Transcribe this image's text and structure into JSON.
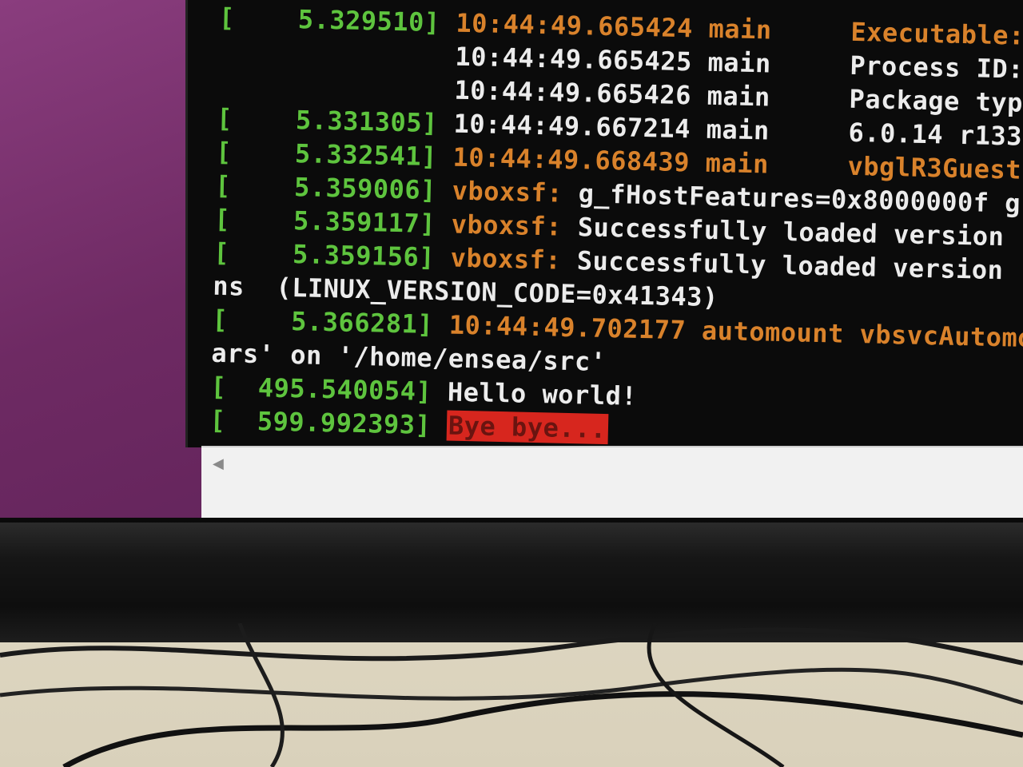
{
  "terminal": {
    "lines": [
      {
        "ts": "[    5.329510]",
        "src": "10:44:49.665424 main",
        "msg": "     Executable:"
      },
      {
        "ts": "",
        "src": "10:44:49.665425 main",
        "msg": "     Process ID:"
      },
      {
        "ts": "",
        "src": "10:44:49.665426 main",
        "msg": "     Package typ"
      },
      {
        "ts": "[    5.331305]",
        "src": "10:44:49.667214 main",
        "msg": "     6.0.14 r133"
      },
      {
        "ts": "[    5.332541]",
        "src": "10:44:49.668439 main",
        "msg": "     vbglR3Guest"
      },
      {
        "ts": "[    5.359006]",
        "src": "vboxsf:",
        "msg": " g_fHostFeatures=0x8000000f g"
      },
      {
        "ts": "[    5.359117]",
        "src": "vboxsf:",
        "msg": " Successfully loaded version"
      },
      {
        "ts": "[    5.359156]",
        "src": "vboxsf:",
        "msg": " Successfully loaded version"
      },
      {
        "ts": "",
        "src": "",
        "msg": "ns  (LINUX_VERSION_CODE=0x41343)"
      },
      {
        "ts": "[    5.366281]",
        "src": "10:44:49.702177 automount vbsvcAutomo",
        "msg": ""
      },
      {
        "ts": "",
        "src": "",
        "msg": "ars' on '/home/ensea/src'"
      },
      {
        "ts": "[  495.540054]",
        "src": "",
        "msg": " Hello world!"
      },
      {
        "ts": "[  599.992393]",
        "src": "",
        "msg": " ",
        "highlight": "Bye bye..."
      }
    ]
  },
  "status_bar": {
    "scroll_icon": "scroll-left-arrow-icon",
    "scroll_glyph": "◀"
  },
  "colors": {
    "timestamp": "#5ec43e",
    "source": "#d9822b",
    "text": "#ececec",
    "highlight_bg": "#d7261e",
    "desktop": "#7a3b6c"
  }
}
